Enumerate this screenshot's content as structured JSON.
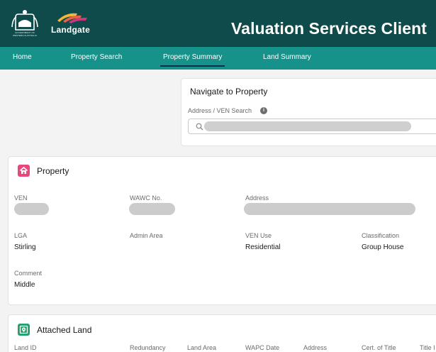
{
  "header": {
    "crest_text": "GOVERNMENT OF WESTERN AUSTRALIA",
    "brand": "Landgate",
    "title": "Valuation Services Client"
  },
  "nav": {
    "items": [
      {
        "label": "Home"
      },
      {
        "label": "Property Search"
      },
      {
        "label": "Property Summary",
        "active": true
      },
      {
        "label": "Land Summary"
      }
    ]
  },
  "navigate": {
    "title": "Navigate to Property",
    "search_label": "Address / VEN Search",
    "info_glyph": "i",
    "search_value_redacted": true
  },
  "property": {
    "title": "Property",
    "fields": {
      "ven": {
        "label": "VEN",
        "redacted": true
      },
      "wawc": {
        "label": "WAWC No.",
        "redacted": true
      },
      "address": {
        "label": "Address",
        "redacted": true
      },
      "lga": {
        "label": "LGA",
        "value": "Stirling"
      },
      "admin_area": {
        "label": "Admin Area",
        "value": ""
      },
      "ven_use": {
        "label": "VEN Use",
        "value": "Residential"
      },
      "classification": {
        "label": "Classification",
        "value": "Group House"
      },
      "comment": {
        "label": "Comment",
        "value": "Middle"
      }
    }
  },
  "attached_land": {
    "title": "Attached Land",
    "columns": [
      "Land ID",
      "Redundancy",
      "Land Area",
      "WAPC Date",
      "Address",
      "Cert. of Title",
      "Title I"
    ]
  },
  "colors": {
    "header_bg": "#0f4b4a",
    "nav_bg": "#17928a",
    "active_underline": "#0e2f4c",
    "property_badge": "#e8467c",
    "land_badge": "#22a06b"
  },
  "icons": {
    "crest": "wa-government-crest-icon",
    "landgate": "landgate-logo-icon",
    "search": "search-icon",
    "info": "info-icon",
    "property": "home-icon",
    "land": "map-pin-icon"
  }
}
